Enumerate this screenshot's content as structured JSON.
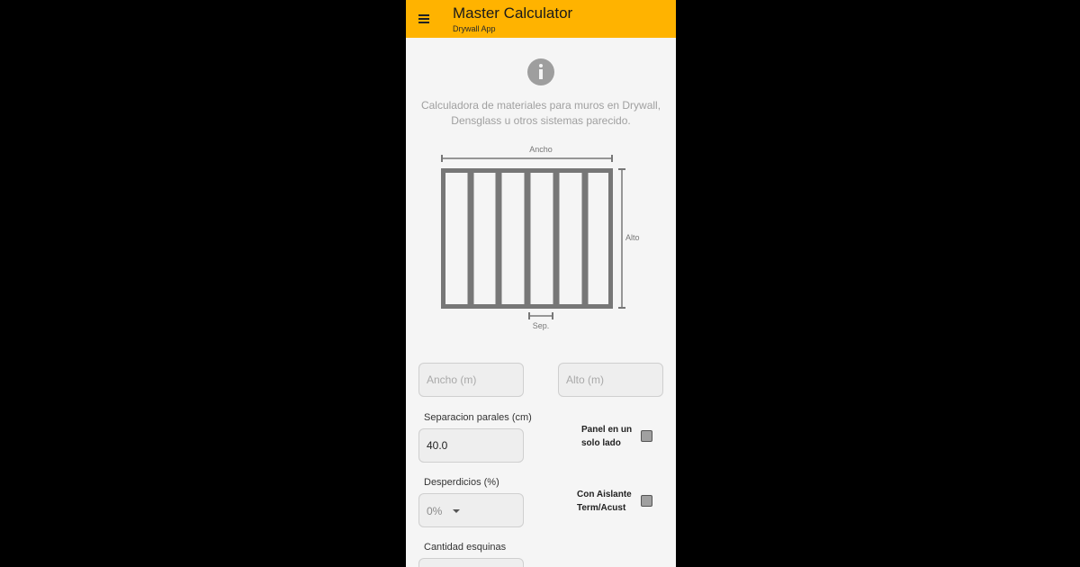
{
  "appbar": {
    "title": "Master Calculator",
    "subtitle": "Drywall App"
  },
  "intro": {
    "description": "Calculadora de materiales para muros en Drywall, Densglass u otros sistemas parecido."
  },
  "diagram": {
    "width_label": "Ancho",
    "height_label": "Alto",
    "separation_label": "Sep."
  },
  "form": {
    "ancho": {
      "placeholder": "Ancho (m)"
    },
    "alto": {
      "placeholder": "Alto (m)"
    },
    "separacion": {
      "label": "Separacion parales (cm)",
      "value": "40.0"
    },
    "panel_un_lado": {
      "label_line1": "Panel en un",
      "label_line2": "solo lado",
      "checked": false
    },
    "desperdicios": {
      "label": "Desperdicios (%)",
      "value": "0%"
    },
    "aislante": {
      "label_line1": "Con Aislante",
      "label_line2": "Term/Acust",
      "checked": false
    },
    "esquinas": {
      "label": "Cantidad esquinas"
    }
  },
  "colors": {
    "accent": "#ffb300",
    "background": "#f5f5f5",
    "diagram": "#777777"
  },
  "icons": {
    "menu": "hamburger-icon",
    "info": "info-icon",
    "dropdown": "caret-down-icon"
  }
}
